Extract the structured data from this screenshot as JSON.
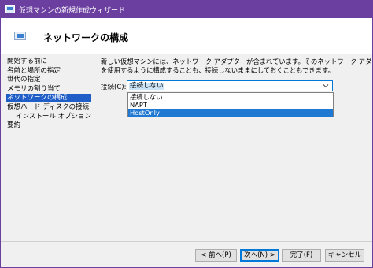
{
  "window": {
    "title": "仮想マシンの新規作成ウィザード"
  },
  "header": {
    "title": "ネットワークの構成",
    "icon": "network-monitor-icon"
  },
  "sidebar": {
    "items": [
      {
        "label": "開始する前に"
      },
      {
        "label": "名前と場所の指定"
      },
      {
        "label": "世代の指定"
      },
      {
        "label": "メモリの割り当て"
      },
      {
        "label": "ネットワークの構成",
        "active": true
      },
      {
        "label": "仮想ハード ディスクの接続"
      },
      {
        "label": "インストール オプション"
      },
      {
        "label": "要約"
      }
    ]
  },
  "main": {
    "description_line1": "新しい仮想マシンには、ネットワーク アダプターが含まれています。そのネットワーク アダプターで仮想スイッチ",
    "description_line2": "を使用するように構成することも、接続しないままにしておくこともできます。",
    "connection_label": "接続(C):",
    "connection_value": "接続しない",
    "options": [
      "接続しない",
      "NAPT",
      "HostOnly"
    ],
    "highlighted_option": "HostOnly"
  },
  "buttons": {
    "back": "< 前へ(P)",
    "next": "次へ(N) >",
    "finish": "完了(F)",
    "cancel": "キャンセル"
  },
  "colors": {
    "titlebar": "#6b3fa0",
    "selection": "#1f5ec7",
    "accent": "#0078d7"
  }
}
